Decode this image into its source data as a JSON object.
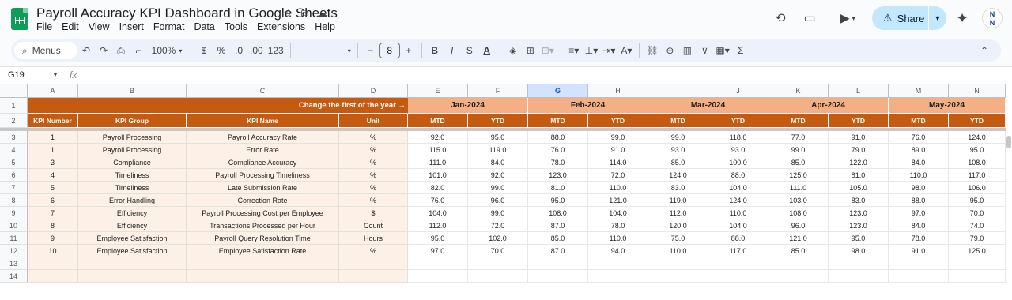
{
  "doc": {
    "title": "Payroll Accuracy KPI Dashboard in Google Sheets",
    "menu": [
      "File",
      "Edit",
      "View",
      "Insert",
      "Format",
      "Data",
      "Tools",
      "Extensions",
      "Help"
    ],
    "share_label": "Share",
    "avatar_text": "N\nN"
  },
  "toolbar": {
    "menus_label": "Menus",
    "zoom": "100%",
    "currency": "$",
    "percent": "%",
    "dec_less": ".0",
    "dec_more": ".00",
    "number_format": "123",
    "font_size": "8"
  },
  "formula_bar": {
    "cell_ref": "G19",
    "fx": "fx",
    "content": ""
  },
  "columns": [
    "A",
    "B",
    "C",
    "D",
    "E",
    "F",
    "G",
    "H",
    "I",
    "J",
    "K",
    "L",
    "M",
    "N"
  ],
  "selected_column": "G",
  "rows": [
    "1",
    "2",
    "3",
    "4",
    "5",
    "6",
    "7",
    "8",
    "9",
    "10",
    "11",
    "12",
    "13",
    "14"
  ],
  "sheet": {
    "header_note": "Change the first of the year →",
    "months": [
      "Jan-2024",
      "Feb-2024",
      "Mar-2024",
      "Apr-2024",
      "May-2024"
    ],
    "sub_headers": [
      "KPI Number",
      "KPI Group",
      "KPI Name",
      "Unit"
    ],
    "mtd": "MTD",
    "ytd": "YTD",
    "kpis": [
      {
        "num": "1",
        "group": "Payroll Processing",
        "name": "Payroll Accuracy Rate",
        "unit": "%",
        "vals": [
          "92.0",
          "95.0",
          "88.0",
          "99.0",
          "99.0",
          "118.0",
          "77.0",
          "91.0",
          "76.0",
          "124.0"
        ]
      },
      {
        "num": "1",
        "group": "Payroll Processing",
        "name": "Error Rate",
        "unit": "%",
        "vals": [
          "115.0",
          "119.0",
          "76.0",
          "91.0",
          "93.0",
          "93.0",
          "99.0",
          "79.0",
          "89.0",
          "95.0"
        ]
      },
      {
        "num": "3",
        "group": "Compliance",
        "name": "Compliance Accuracy",
        "unit": "%",
        "vals": [
          "111.0",
          "84.0",
          "78.0",
          "114.0",
          "85.0",
          "100.0",
          "85.0",
          "122.0",
          "84.0",
          "108.0"
        ]
      },
      {
        "num": "4",
        "group": "Timeliness",
        "name": "Payroll Processing Timeliness",
        "unit": "%",
        "vals": [
          "101.0",
          "92.0",
          "123.0",
          "72.0",
          "124.0",
          "88.0",
          "125.0",
          "81.0",
          "110.0",
          "117.0"
        ]
      },
      {
        "num": "5",
        "group": "Timeliness",
        "name": "Late Submission Rate",
        "unit": "%",
        "vals": [
          "82.0",
          "99.0",
          "81.0",
          "110.0",
          "83.0",
          "104.0",
          "111.0",
          "105.0",
          "98.0",
          "106.0"
        ]
      },
      {
        "num": "6",
        "group": "Error Handling",
        "name": "Correction Rate",
        "unit": "%",
        "vals": [
          "76.0",
          "96.0",
          "95.0",
          "121.0",
          "119.0",
          "124.0",
          "103.0",
          "83.0",
          "88.0",
          "95.0"
        ]
      },
      {
        "num": "7",
        "group": "Efficiency",
        "name": "Payroll Processing Cost per Employee",
        "unit": "$",
        "vals": [
          "104.0",
          "99.0",
          "108.0",
          "104.0",
          "112.0",
          "110.0",
          "108.0",
          "123.0",
          "97.0",
          "70.0"
        ]
      },
      {
        "num": "8",
        "group": "Efficiency",
        "name": "Transactions Processed per Hour",
        "unit": "Count",
        "vals": [
          "112.0",
          "72.0",
          "87.0",
          "78.0",
          "120.0",
          "104.0",
          "96.0",
          "123.0",
          "84.0",
          "74.0"
        ]
      },
      {
        "num": "9",
        "group": "Employee Satisfaction",
        "name": "Payroll Query Resolution Time",
        "unit": "Hours",
        "vals": [
          "95.0",
          "102.0",
          "85.0",
          "110.0",
          "75.0",
          "88.0",
          "121.0",
          "95.0",
          "78.0",
          "79.0"
        ]
      },
      {
        "num": "10",
        "group": "Employee Satisfaction",
        "name": "Employee Satisfaction Rate",
        "unit": "%",
        "vals": [
          "97.0",
          "70.0",
          "87.0",
          "94.0",
          "110.0",
          "117.0",
          "85.0",
          "98.0",
          "91.0",
          "125.0"
        ]
      }
    ]
  }
}
